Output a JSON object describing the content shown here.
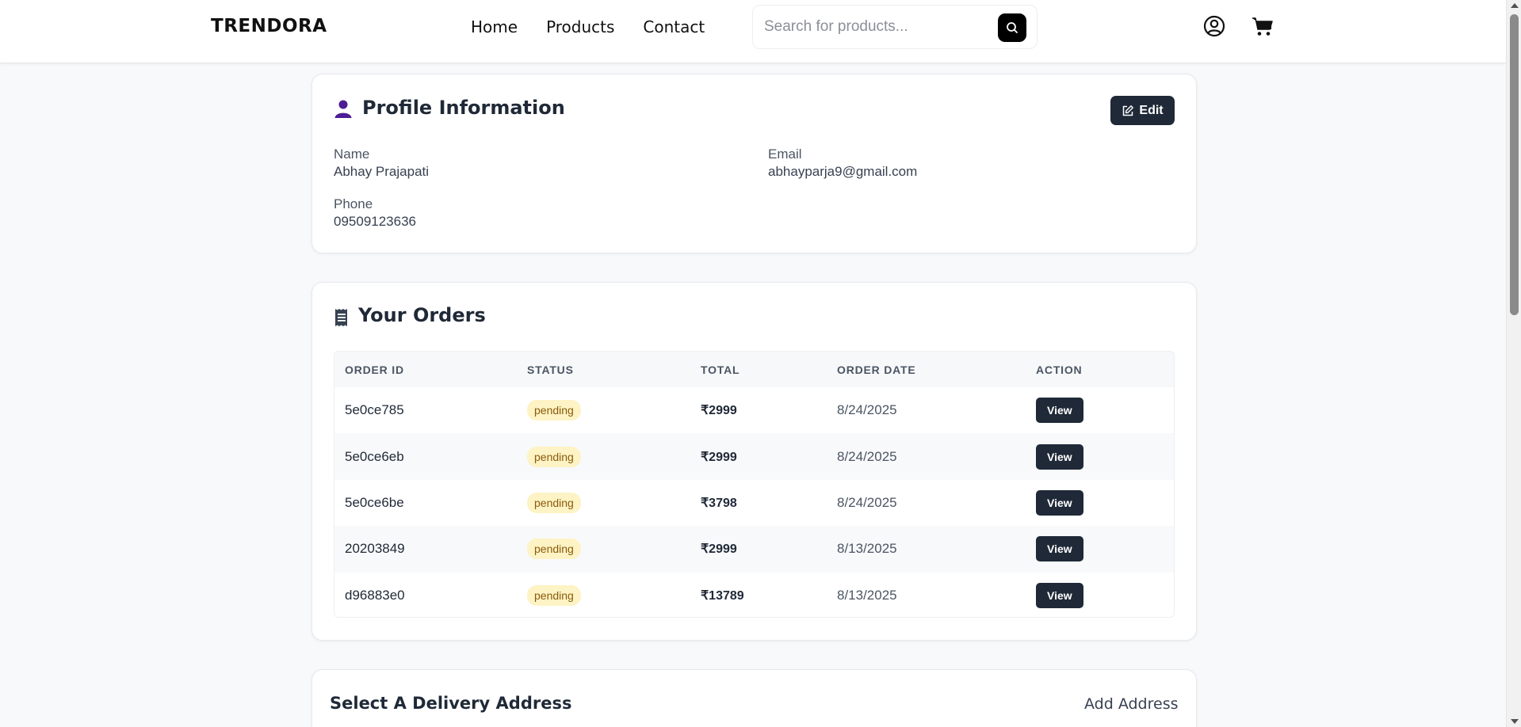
{
  "header": {
    "logo": "TRENDORA",
    "nav": [
      "Home",
      "Products",
      "Contact"
    ],
    "search_placeholder": "Search for products..."
  },
  "profile": {
    "title": "Profile Information",
    "edit_label": "Edit",
    "name_label": "Name",
    "name_value": "Abhay Prajapati",
    "email_label": "Email",
    "email_value": "abhayparja9@gmail.com",
    "phone_label": "Phone",
    "phone_value": "09509123636"
  },
  "orders": {
    "title": "Your Orders",
    "columns": [
      "ORDER ID",
      "STATUS",
      "TOTAL",
      "ORDER DATE",
      "ACTION"
    ],
    "rows": [
      {
        "id": "5e0ce785",
        "status": "pending",
        "total": "₹2999",
        "date": "8/24/2025",
        "action": "View"
      },
      {
        "id": "5e0ce6eb",
        "status": "pending",
        "total": "₹2999",
        "date": "8/24/2025",
        "action": "View"
      },
      {
        "id": "5e0ce6be",
        "status": "pending",
        "total": "₹3798",
        "date": "8/24/2025",
        "action": "View"
      },
      {
        "id": "20203849",
        "status": "pending",
        "total": "₹2999",
        "date": "8/13/2025",
        "action": "View"
      },
      {
        "id": "d96883e0",
        "status": "pending",
        "total": "₹13789",
        "date": "8/13/2025",
        "action": "View"
      }
    ]
  },
  "address": {
    "title": "Select A Delivery Address",
    "add_label": "Add Address"
  },
  "colors": {
    "primary_dark": "#1f2937",
    "badge_bg": "#fdf3c4",
    "badge_text": "#8a5a0a",
    "profile_icon": "#4c1d95"
  },
  "icons": [
    "search-icon",
    "user-circle-icon",
    "cart-icon",
    "user-icon",
    "edit-icon",
    "receipt-icon"
  ]
}
